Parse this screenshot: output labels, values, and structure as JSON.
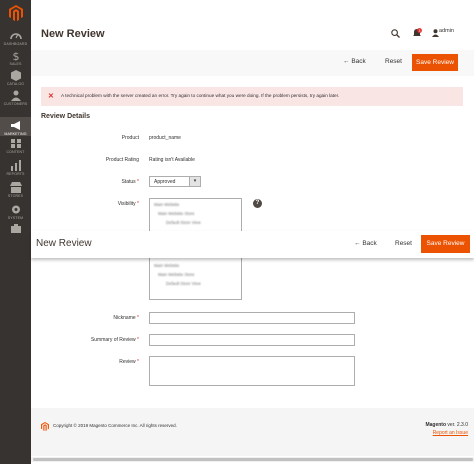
{
  "sidebar": {
    "items": [
      {
        "label": "DASHBOARD",
        "icon": "dashboard-icon"
      },
      {
        "label": "SALES",
        "icon": "dollar-icon"
      },
      {
        "label": "CATALOG",
        "icon": "box-icon"
      },
      {
        "label": "CUSTOMERS",
        "icon": "customers-icon"
      },
      {
        "label": "MARKETING",
        "icon": "megaphone-icon"
      },
      {
        "label": "CONTENT",
        "icon": "content-icon"
      },
      {
        "label": "REPORTS",
        "icon": "bar-chart-icon"
      },
      {
        "label": "STORES",
        "icon": "store-icon"
      },
      {
        "label": "SYSTEM",
        "icon": "gear-icon"
      },
      {
        "label": "",
        "icon": "extension-icon"
      }
    ],
    "active_index": 4
  },
  "header": {
    "title": "New Review",
    "notification_count": "3",
    "user": "admin"
  },
  "actions": {
    "back": "Back",
    "reset": "Reset",
    "save": "Save Review"
  },
  "error_message": "A technical problem with the server created an error. Try again to continue what you were doing. If the problem persists, try again later.",
  "section_title": "Review Details",
  "form": {
    "product_label": "Product",
    "product_value": "product_name",
    "rating_label": "Product Rating",
    "rating_value": "Rating isn't Available",
    "status_label": "Status",
    "status_value": "Approved",
    "visibility_label": "Visibility",
    "visibility_options": [
      "Main Website",
      "Main Website Store",
      "Default Store View",
      "",
      "Main Website",
      "Main Website Store",
      "Default Store View"
    ],
    "nickname_label": "Nickname",
    "summary_label": "Summary of Review",
    "review_label": "Review"
  },
  "footer": {
    "copyright": "Copyright © 2019 Magento Commerce Inc. All rights reserved.",
    "brand": "Magento",
    "version": " ver. 2.3.0",
    "report": "Report an Issue"
  },
  "colors": {
    "accent": "#eb5202",
    "sidebar_bg": "#373330",
    "error_bg": "#fae5e5"
  }
}
